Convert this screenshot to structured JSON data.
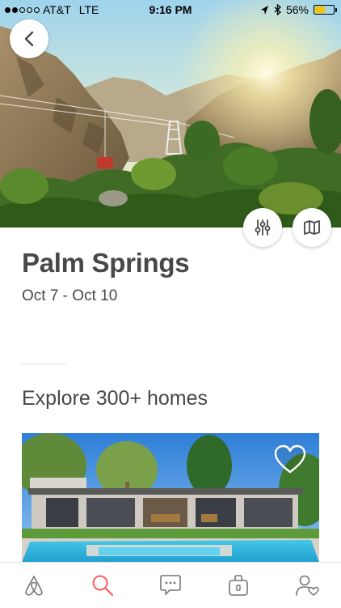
{
  "status_bar": {
    "carrier": "AT&T",
    "network": "LTE",
    "time": "9:16 PM",
    "battery_percent": "56%",
    "battery_level": 0.56,
    "signal_bars": 2
  },
  "hero": {
    "image": "Palm Springs aerial tramway in mountain canyon at sunset",
    "back_icon": "chevron-left-icon"
  },
  "actions": {
    "filter_icon": "sliders-icon",
    "map_icon": "map-icon"
  },
  "trip": {
    "city": "Palm Springs",
    "dates": "Oct 7 - Oct 10"
  },
  "explore": {
    "heading": "Explore 300+ homes"
  },
  "listing": {
    "image": "Mid-century home with swimming pool",
    "favorite_icon": "heart-outline-icon"
  },
  "tab_bar": {
    "tabs": [
      {
        "name": "explore",
        "icon": "airbnb-logo-icon",
        "active": false
      },
      {
        "name": "search",
        "icon": "search-icon",
        "active": true
      },
      {
        "name": "messages",
        "icon": "message-icon",
        "active": false
      },
      {
        "name": "trips",
        "icon": "suitcase-icon",
        "active": false
      },
      {
        "name": "profile",
        "icon": "profile-icon",
        "active": false
      }
    ]
  },
  "colors": {
    "accent": "#FF5A5F",
    "text": "#484848",
    "icon": "#767676",
    "battery": "#F5C400"
  }
}
